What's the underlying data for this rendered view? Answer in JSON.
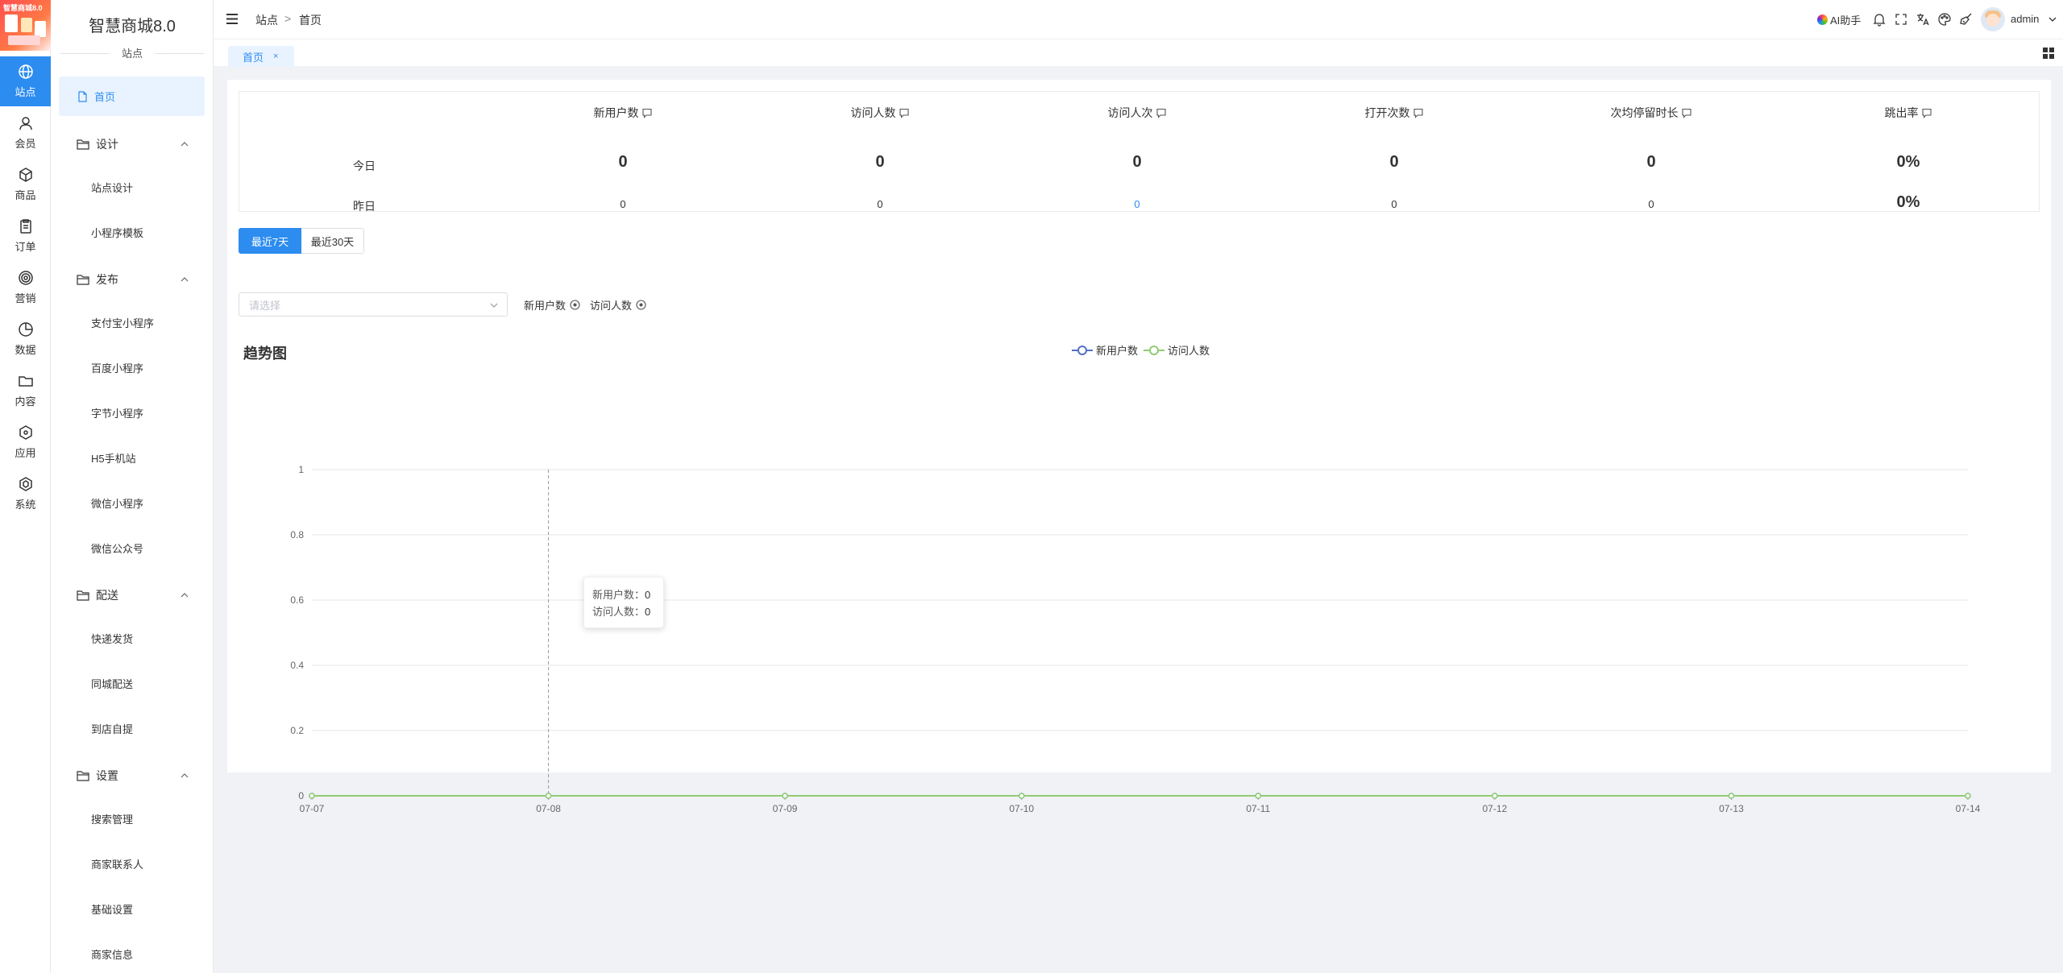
{
  "app": {
    "brand": "智慧商城8.0",
    "logo_text": "智慧商城8.0",
    "section": "站点"
  },
  "rail": [
    {
      "label": "站点",
      "icon": "globe-icon",
      "active": true
    },
    {
      "label": "会员",
      "icon": "user-icon"
    },
    {
      "label": "商品",
      "icon": "box-icon"
    },
    {
      "label": "订单",
      "icon": "clipboard-icon"
    },
    {
      "label": "营销",
      "icon": "target-icon"
    },
    {
      "label": "数据",
      "icon": "pie-chart-icon"
    },
    {
      "label": "内容",
      "icon": "folder-icon"
    },
    {
      "label": "应用",
      "icon": "cube-icon"
    },
    {
      "label": "系统",
      "icon": "hexagon-icon"
    }
  ],
  "menu": {
    "home": "首页",
    "groups": [
      {
        "title": "设计",
        "items": [
          "站点设计",
          "小程序模板"
        ]
      },
      {
        "title": "发布",
        "items": [
          "支付宝小程序",
          "百度小程序",
          "字节小程序",
          "H5手机站",
          "微信小程序",
          "微信公众号"
        ]
      },
      {
        "title": "配送",
        "items": [
          "快递发货",
          "同城配送",
          "到店自提"
        ]
      },
      {
        "title": "设置",
        "items": [
          "搜索管理",
          "商家联系人",
          "基础设置",
          "商家信息"
        ]
      }
    ]
  },
  "header": {
    "breadcrumb": [
      "站点",
      "首页"
    ],
    "breadcrumb_sep": ">",
    "ai_label": "AI助手",
    "user": "admin"
  },
  "tabs": [
    {
      "label": "首页",
      "close": "×"
    }
  ],
  "stats": {
    "headers": [
      "新用户数",
      "访问人数",
      "访问人次",
      "打开次数",
      "次均停留时长",
      "跳出率"
    ],
    "rows": [
      {
        "label": "今日",
        "values": [
          "0",
          "0",
          "0",
          "0",
          "0",
          "0%"
        ]
      },
      {
        "label": "昨日",
        "values": [
          "0",
          "0",
          "0",
          "0",
          "0",
          "0%"
        ]
      }
    ]
  },
  "filters": {
    "range_buttons": [
      "最近7天",
      "最近30天"
    ],
    "active_range": "最近7天",
    "select_placeholder": "请选择",
    "chips": [
      "新用户数",
      "访问人数"
    ]
  },
  "chart_data": {
    "type": "line",
    "title": "趋势图",
    "x": [
      "07-07",
      "07-08",
      "07-09",
      "07-10",
      "07-11",
      "07-12",
      "07-13",
      "07-14"
    ],
    "series": [
      {
        "name": "新用户数",
        "values": [
          0,
          0,
          0,
          0,
          0,
          0,
          0,
          0
        ],
        "color": "#5470c6"
      },
      {
        "name": "访问人数",
        "values": [
          0,
          0,
          0,
          0,
          0,
          0,
          0,
          0
        ],
        "color": "#91cc75"
      }
    ],
    "yticks": [
      "0",
      "0.2",
      "0.4",
      "0.6",
      "0.8",
      "1"
    ],
    "ylim": [
      0,
      1
    ],
    "grid": true,
    "legend": "top-center",
    "tooltip": {
      "category": "07-08",
      "rows": [
        {
          "label": "新用户数：",
          "value": "0"
        },
        {
          "label": "访问人数：",
          "value": "0"
        }
      ]
    }
  },
  "colors": {
    "primary": "#2d8cf0",
    "series1": "#5470c6",
    "series2": "#91cc75"
  }
}
